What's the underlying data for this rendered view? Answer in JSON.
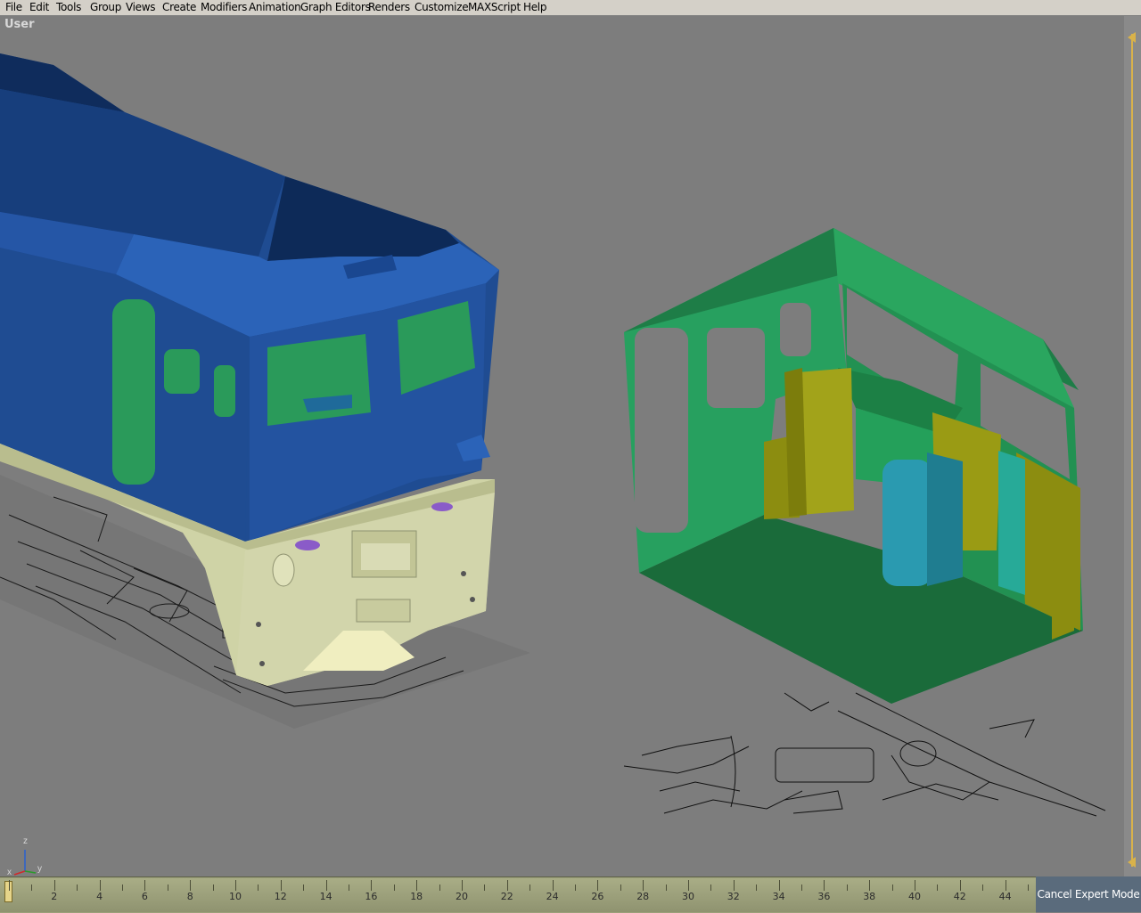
{
  "menu": [
    "File",
    "Edit",
    "Tools",
    "Group",
    "Views",
    "Create",
    "Modifiers",
    "Animation",
    "Graph Editors",
    "Renders",
    "Customize",
    "MAXScript",
    "Help"
  ],
  "viewport": {
    "label": "User"
  },
  "axis": {
    "z": "z",
    "x": "x",
    "y": "y"
  },
  "timeline": {
    "ticks": [
      "2",
      "4",
      "6",
      "8",
      "10",
      "12",
      "14",
      "16",
      "18",
      "20",
      "22",
      "24",
      "26",
      "28",
      "30",
      "32",
      "34",
      "36",
      "38",
      "40",
      "42",
      "44"
    ],
    "current_frame": 0
  },
  "cancel_button": {
    "label": "Cancel Expert Mode"
  },
  "colors": {
    "viewport_bg": "#7d7d7d",
    "loco_blue": "#2a5aa8",
    "loco_cream": "#cfd3a6",
    "cab_green": "#2a9a5a",
    "seat_olive": "#8b8c10",
    "seat_cyan": "#2a9ab0",
    "timeline": "#9ca07a",
    "accent": "#d9b24a"
  },
  "icons": {
    "scroll_up": "triangle-left-icon",
    "scroll_down": "triangle-left-icon",
    "gizmo": "axis-tripod-icon"
  }
}
